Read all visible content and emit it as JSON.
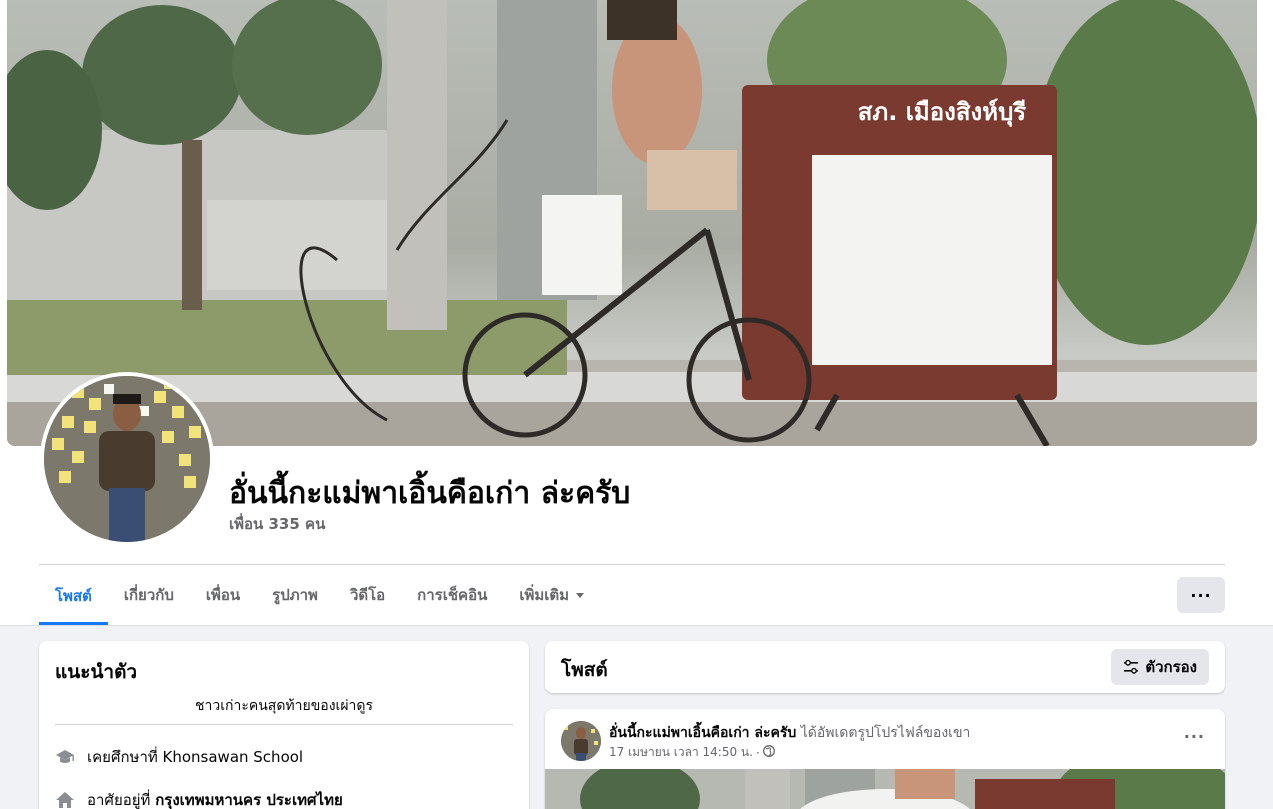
{
  "profile": {
    "name": "อั่นนี้กะแม่พาเอิ้นคือเก่า ล่ะครับ",
    "friends": "เพื่อน 335 คน",
    "cover_sign_text": "สภ. เมืองสิงห์บุรี"
  },
  "tabs": [
    {
      "label": "โพสต์",
      "active": true
    },
    {
      "label": "เกี่ยวกับ",
      "active": false
    },
    {
      "label": "เพื่อน",
      "active": false
    },
    {
      "label": "รูปภาพ",
      "active": false
    },
    {
      "label": "วิดีโอ",
      "active": false
    },
    {
      "label": "การเช็คอิน",
      "active": false
    },
    {
      "label": "เพิ่มเติม",
      "active": false
    }
  ],
  "more_button": "···",
  "intro": {
    "title": "แนะนำตัว",
    "bio": "ชาวเก่าะคนสุดท้ายของเผ่าดูร",
    "education_prefix": "เคยศึกษาที่ Khonsawan School",
    "lives_prefix": "อาศัยอยู่ที่",
    "lives_place": "กรุงเทพมหานคร ประเทศไทย"
  },
  "posts_header": {
    "title": "โพสต์",
    "filter_label": "ตัวกรอง"
  },
  "post": {
    "author": "อั่นนี้กะแม่พาเอิ้นคือเก่า ล่ะครับ",
    "action": "ได้อัพเดตรูปโปรไฟล์ของเขา",
    "timestamp": "17 เมษายน เวลา 14:50 น.",
    "separator": "·",
    "more": "···"
  },
  "colors": {
    "accent": "#1877f2",
    "secondary_text": "#65676b",
    "button_bg": "#e4e6eb",
    "page_bg": "#f0f2f5"
  }
}
